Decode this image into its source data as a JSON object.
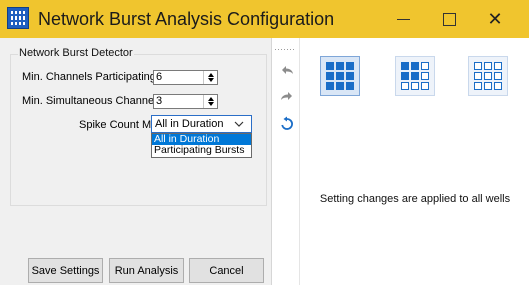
{
  "window": {
    "title": "Network Burst Analysis Configuration",
    "minimize_icon": "minimize-icon",
    "maximize_icon": "maximize-icon",
    "close_label": "✕"
  },
  "detector": {
    "legend": "Network Burst Detector",
    "min_channels_label": "Min. Channels Participating:",
    "min_channels_value": "6",
    "min_simultaneous_label": "Min. Simultaneous Channels:",
    "min_simultaneous_value": "3",
    "spike_mode_label": "Spike Count Mode:",
    "spike_mode_value": "All in Duration",
    "spike_mode_options": [
      "All in Duration",
      "Participating Bursts"
    ],
    "spike_mode_selected_index": 0
  },
  "buttons": {
    "save": "Save Settings",
    "run": "Run Analysis",
    "cancel": "Cancel"
  },
  "toolbar": {
    "icons": [
      "undo-icon",
      "redo-icon",
      "reset-icon"
    ]
  },
  "layouts": {
    "icons": [
      "plate-filled-layout-icon",
      "plate-mixed-layout-icon",
      "plate-outline-layout-icon"
    ]
  },
  "info": {
    "message": "Setting changes are applied to all wells"
  },
  "colors": {
    "titlebar": "#f0c52e",
    "accent": "#0078d7",
    "well_blue": "#1a6dc7"
  }
}
